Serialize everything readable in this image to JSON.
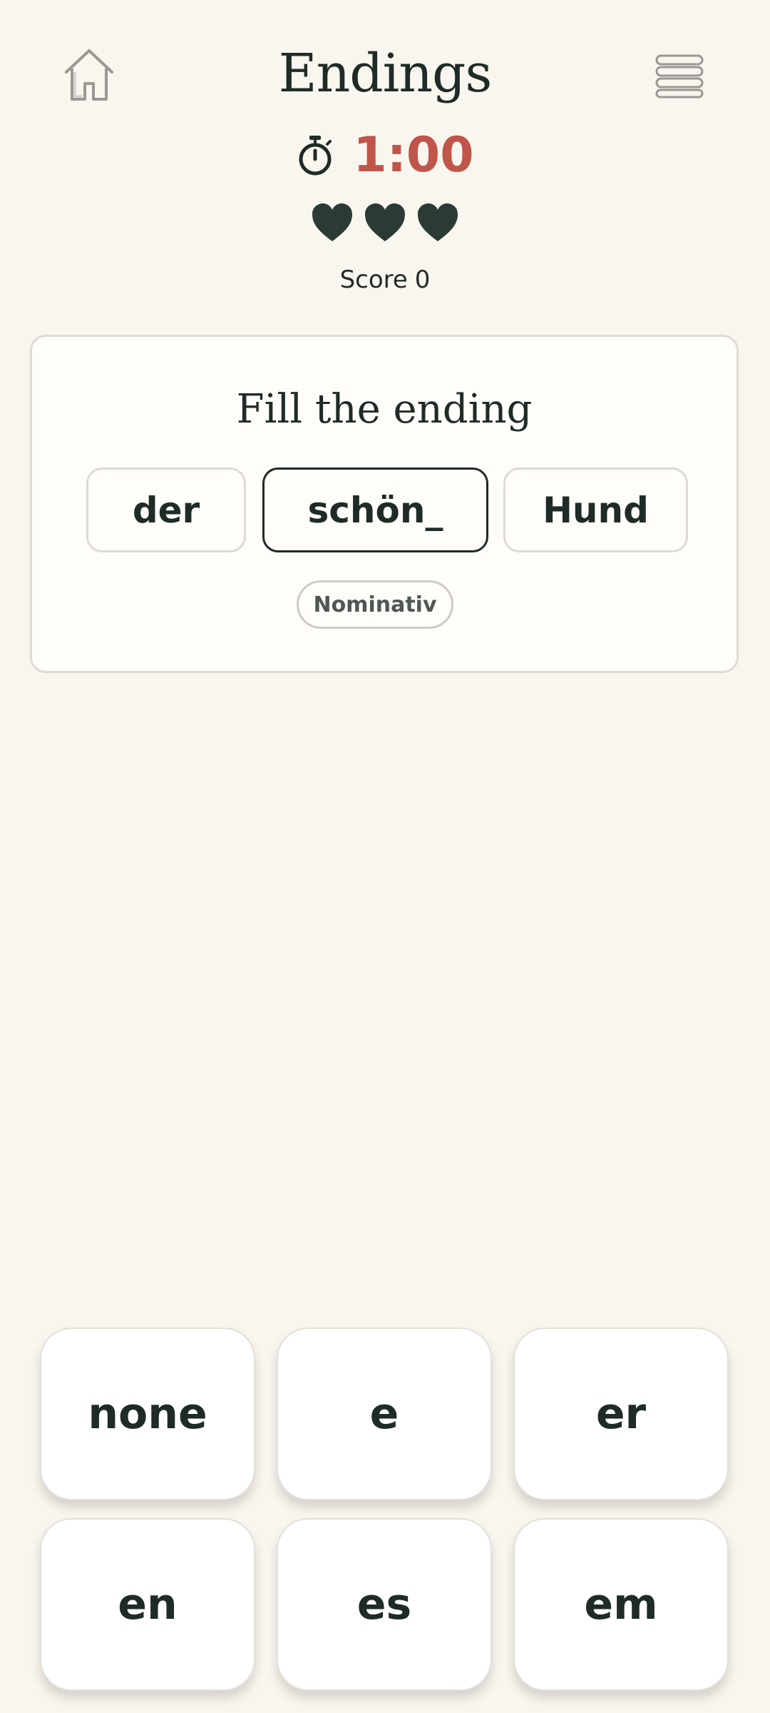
{
  "header": {
    "title": "Endings",
    "home_icon": "home-icon",
    "menu_icon": "menu-icon"
  },
  "timer": {
    "icon": "stopwatch-icon",
    "value": "1:00",
    "color": "#c0554a"
  },
  "lives": {
    "count": 3,
    "icon": "heart-icon",
    "color": "#2b3a34"
  },
  "score": {
    "label": "Score",
    "value": "0"
  },
  "question": {
    "prompt": "Fill the ending",
    "words": [
      "der",
      "schön_",
      "Hund"
    ],
    "active_index": 1,
    "case_label": "Nominativ"
  },
  "options": [
    "none",
    "e",
    "er",
    "en",
    "es",
    "em"
  ],
  "colors": {
    "background": "#f9f5ef",
    "card": "#fefdf9",
    "text": "#1f2b26",
    "accent": "#c0554a"
  }
}
